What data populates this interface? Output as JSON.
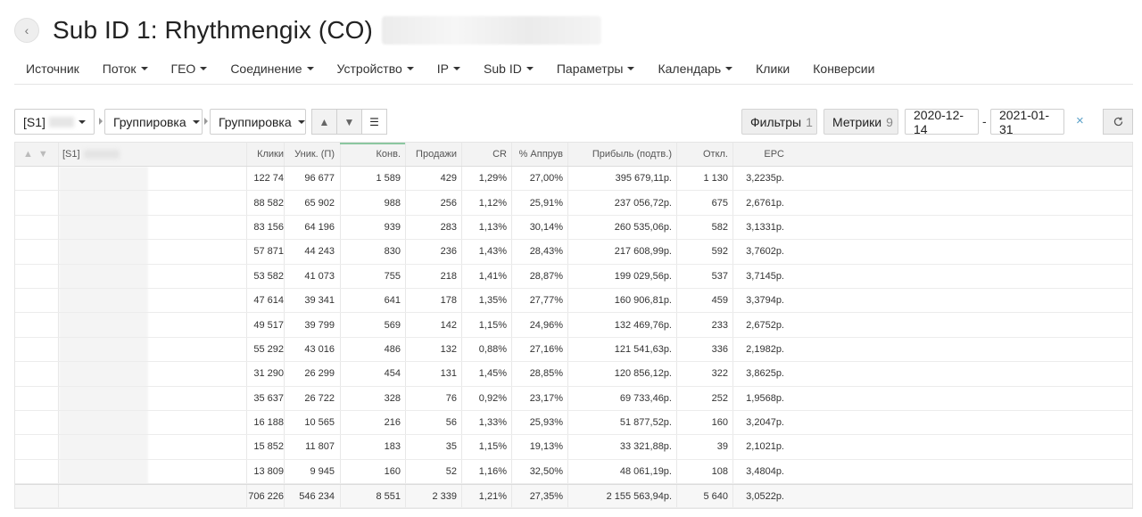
{
  "header": {
    "title": "Sub ID 1: Rhythmengix (CO)"
  },
  "nav": [
    {
      "label": "Источник",
      "dropdown": false
    },
    {
      "label": "Поток",
      "dropdown": true
    },
    {
      "label": "ГЕО",
      "dropdown": true
    },
    {
      "label": "Соединение",
      "dropdown": true
    },
    {
      "label": "Устройство",
      "dropdown": true
    },
    {
      "label": "IP",
      "dropdown": true
    },
    {
      "label": "Sub ID",
      "dropdown": true
    },
    {
      "label": "Параметры",
      "dropdown": true
    },
    {
      "label": "Календарь",
      "dropdown": true
    },
    {
      "label": "Клики",
      "dropdown": false
    },
    {
      "label": "Конверсии",
      "dropdown": false
    }
  ],
  "toolbar": {
    "source_select": "[S1]",
    "grouping1": "Группировка",
    "grouping2": "Группировка",
    "filters_label": "Фильтры",
    "filters_count": "1",
    "metrics_label": "Метрики",
    "metrics_count": "9",
    "date_from": "2020-12-14",
    "date_sep": "-",
    "date_to": "2021-01-31",
    "clear": "×"
  },
  "table": {
    "name_header": "[S1]",
    "columns": [
      "Клики",
      "Уник. (П)",
      "Конв.",
      "Продажи",
      "CR",
      "% Аппрув",
      "Прибыль (подтв.)",
      "Откл.",
      "EPC"
    ],
    "rows": [
      [
        "122 74",
        "96 677",
        "1 589",
        "429",
        "1,29%",
        "27,00%",
        "395 679,11р.",
        "1 130",
        "3,2235р."
      ],
      [
        "88 582",
        "65 902",
        "988",
        "256",
        "1,12%",
        "25,91%",
        "237 056,72р.",
        "675",
        "2,6761р."
      ],
      [
        "83 156",
        "64 196",
        "939",
        "283",
        "1,13%",
        "30,14%",
        "260 535,06р.",
        "582",
        "3,1331р."
      ],
      [
        "57 871",
        "44 243",
        "830",
        "236",
        "1,43%",
        "28,43%",
        "217 608,99р.",
        "592",
        "3,7602р."
      ],
      [
        "53 582",
        "41 073",
        "755",
        "218",
        "1,41%",
        "28,87%",
        "199 029,56р.",
        "537",
        "3,7145р."
      ],
      [
        "47 614",
        "39 341",
        "641",
        "178",
        "1,35%",
        "27,77%",
        "160 906,81р.",
        "459",
        "3,3794р."
      ],
      [
        "49 517",
        "39 799",
        "569",
        "142",
        "1,15%",
        "24,96%",
        "132 469,76р.",
        "233",
        "2,6752р."
      ],
      [
        "55 292",
        "43 016",
        "486",
        "132",
        "0,88%",
        "27,16%",
        "121 541,63р.",
        "336",
        "2,1982р."
      ],
      [
        "31 290",
        "26 299",
        "454",
        "131",
        "1,45%",
        "28,85%",
        "120 856,12р.",
        "322",
        "3,8625р."
      ],
      [
        "35 637",
        "26 722",
        "328",
        "76",
        "0,92%",
        "23,17%",
        "69 733,46р.",
        "252",
        "1,9568р."
      ],
      [
        "16 188",
        "10 565",
        "216",
        "56",
        "1,33%",
        "25,93%",
        "51 877,52р.",
        "160",
        "3,2047р."
      ],
      [
        "15 852",
        "11 807",
        "183",
        "35",
        "1,15%",
        "19,13%",
        "33 321,88р.",
        "39",
        "2,1021р."
      ],
      [
        "13 809",
        "9 945",
        "160",
        "52",
        "1,16%",
        "32,50%",
        "48 061,19р.",
        "108",
        "3,4804р."
      ]
    ],
    "totals": [
      "706 226",
      "546 234",
      "8 551",
      "2 339",
      "1,21%",
      "27,35%",
      "2 155 563,94р.",
      "5 640",
      "3,0522р."
    ]
  }
}
